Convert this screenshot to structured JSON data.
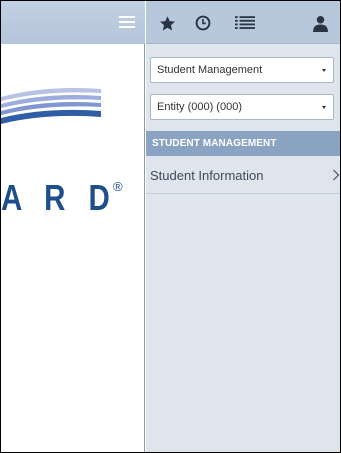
{
  "brand": {
    "logo_text": "A R D",
    "registered_mark": "®",
    "colors": {
      "swoosh_light": "#a9b6e0",
      "swoosh_dark": "#2f5da6",
      "text": "#1f4e8c"
    }
  },
  "left_topbar": {
    "menu_icon": "hamburger-menu-icon"
  },
  "toolbar": {
    "icons": [
      "star-icon",
      "clock-icon",
      "list-icon",
      "user-icon"
    ]
  },
  "selectors": {
    "module": {
      "value": "Student Management"
    },
    "entity": {
      "value": "Entity (000) (000)"
    }
  },
  "menu": {
    "section_title": "STUDENT MANAGEMENT",
    "items": [
      {
        "label": "Student Information",
        "icon": "chevron-right-icon"
      }
    ]
  },
  "colors": {
    "topbar": "#b4c4da",
    "panel_bg": "#dfe5ed",
    "section_header": "#8aa3c2",
    "icon_dark": "#2a3442"
  }
}
